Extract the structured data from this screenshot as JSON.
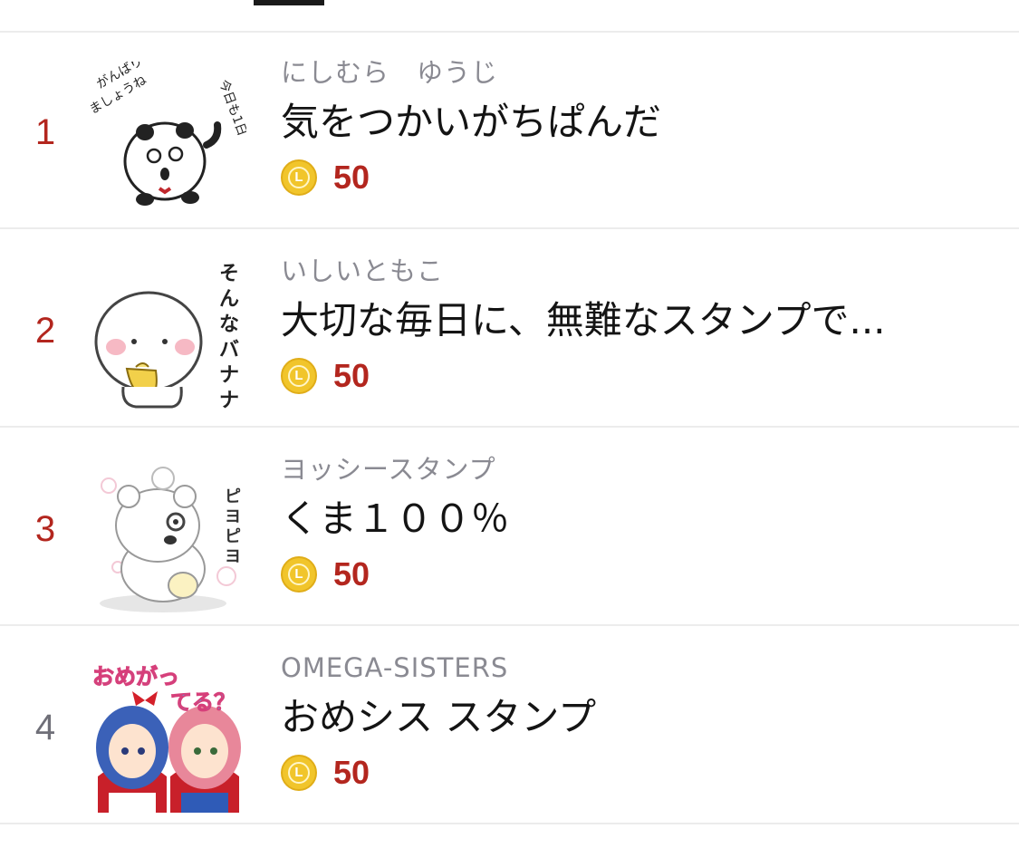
{
  "colors": {
    "rank_top": "#b3261e",
    "rank_plain": "#6f6f78",
    "price": "#b3261e",
    "coin": "#f1c52b"
  },
  "items": [
    {
      "rank": "1",
      "author": "にしむら　ゆうじ",
      "title": "気をつかいがちぱんだ",
      "price": "50",
      "coin_icon": "line-coin-icon",
      "coin_letter": "L",
      "thumb_text": "今日も1日 がんばりましょうね",
      "thumb_icon": "panda-sticker-image"
    },
    {
      "rank": "2",
      "author": "いしいともこ",
      "title": "大切な毎日に、無難なスタンプで...",
      "price": "50",
      "coin_icon": "line-coin-icon",
      "coin_letter": "L",
      "thumb_text": "そんなバナナ",
      "thumb_icon": "banana-sticker-image"
    },
    {
      "rank": "3",
      "author": "ヨッシースタンプ",
      "title": "くま１００％",
      "price": "50",
      "coin_icon": "line-coin-icon",
      "coin_letter": "L",
      "thumb_text": "ピヨピヨ",
      "thumb_icon": "bear-sticker-image"
    },
    {
      "rank": "4",
      "author": "OMEGA-SISTERS",
      "title": "おめシス スタンプ",
      "price": "50",
      "coin_icon": "line-coin-icon",
      "coin_letter": "L",
      "thumb_text": "おめがってる？",
      "thumb_icon": "omega-sisters-sticker-image"
    }
  ]
}
